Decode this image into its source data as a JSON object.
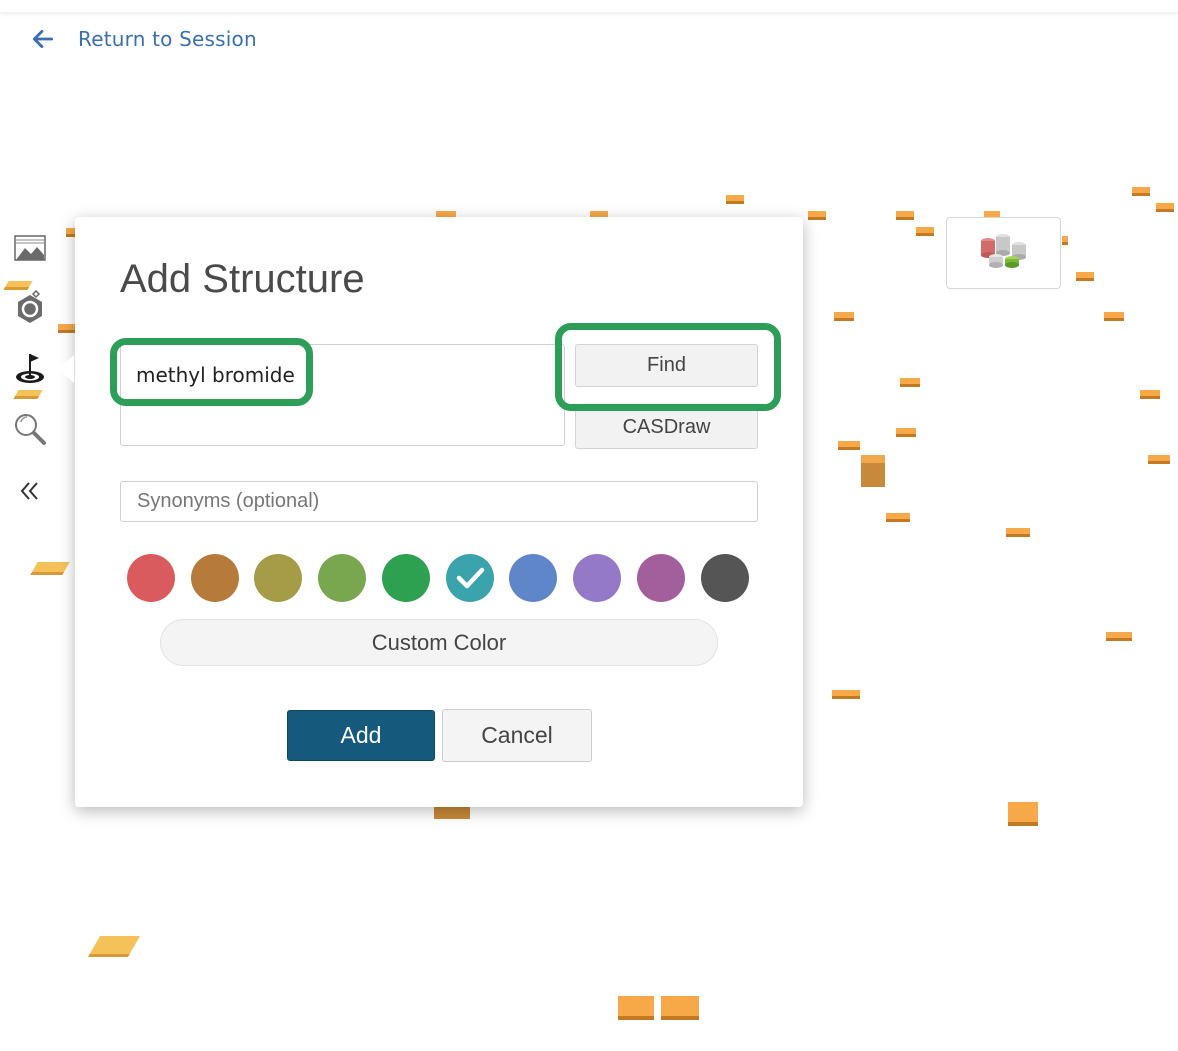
{
  "nav": {
    "back_label": "Return to Session",
    "back_icon": "arrow-left-icon"
  },
  "toolbar": {
    "items": [
      {
        "icon": "landscape-image-icon"
      },
      {
        "icon": "molecule-hexagon-icon"
      },
      {
        "icon": "target-flag-icon"
      },
      {
        "icon": "magnifier-icon"
      },
      {
        "icon": "collapse-double-chevron-left-icon"
      }
    ]
  },
  "widget": {
    "icon": "3d-molecule-stack-icon"
  },
  "modal": {
    "title": "Add Structure",
    "name_value": "methyl bromide",
    "find_label": "Find",
    "casdraw_label": "CASDraw",
    "synonyms_placeholder": "Synonyms (optional)",
    "colors": [
      "#d95b5e",
      "#b67a3b",
      "#a69b46",
      "#79a74f",
      "#2ea151",
      "#3ba3ab",
      "#5f86c9",
      "#9379c7",
      "#a25f9c",
      "#555555"
    ],
    "selected_color_index": 5,
    "custom_color_label": "Custom Color",
    "add_label": "Add",
    "cancel_label": "Cancel"
  },
  "accent_colors": {
    "link": "#3a6fb0",
    "primary_button": "#155a7c",
    "highlight": "#2c9e57",
    "tile": "#f7a849"
  }
}
